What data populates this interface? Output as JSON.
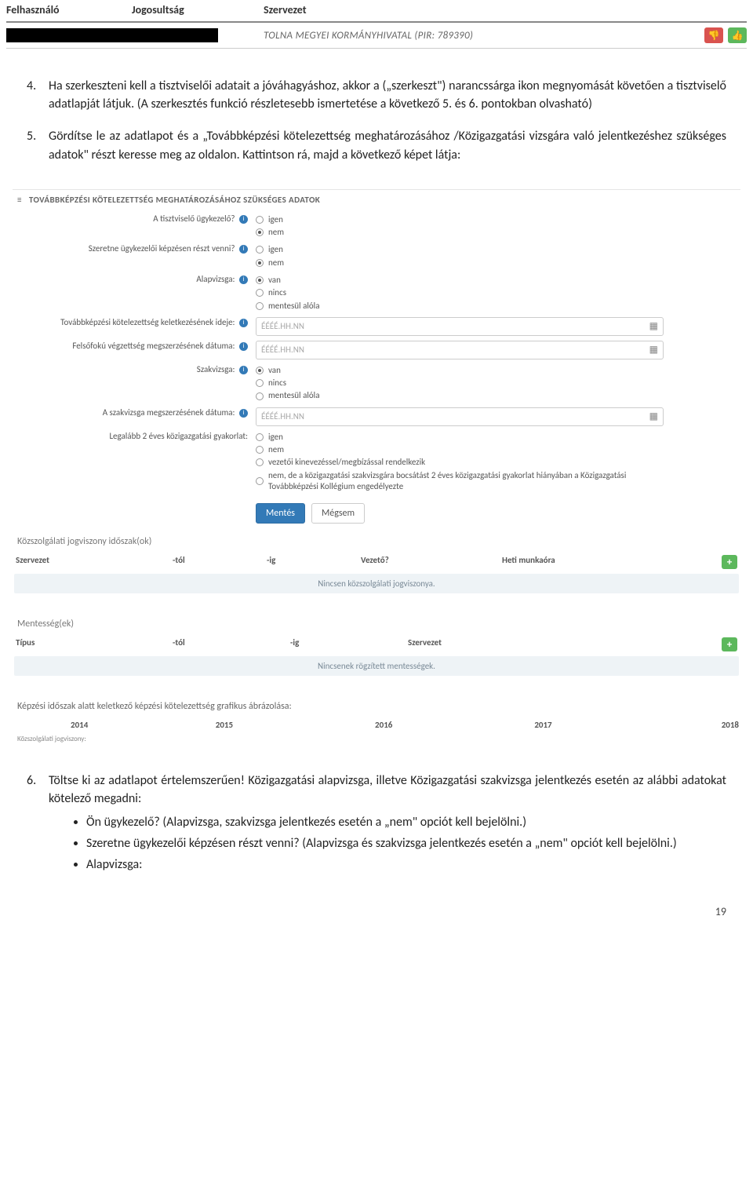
{
  "top": {
    "col1": "Felhasználó",
    "col2": "Jogosultság",
    "col3": "Szervezet",
    "org": "TOLNA MEGYEI KORMÁNYHIVATAL (PIR: 789390)"
  },
  "doc": {
    "p4_num": "4.",
    "p4": "Ha szerkeszteni kell a tisztviselői adatait a jóváhagyáshoz, akkor a („szerkeszt\") narancssárga ikon megnyomását követően a tisztviselő adatlapját látjuk. (A szerkesztés funkció részletesebb ismertetése a következő 5. és 6. pontokban olvasható)",
    "p5_num": "5.",
    "p5": "Gördítse le az adatlapot és a „Továbbképzési kötelezettség meghatározásához /Közigazgatási vizsgára való jelentkezéshez szükséges adatok\" részt keresse meg az oldalon. Kattintson rá, majd a következő képet látja:",
    "p6_num": "6.",
    "p6": "Töltse ki az adatlapot értelemszerűen! Közigazgatási alapvizsga, illetve Közigazgatási szakvizsga jelentkezés esetén az alábbi adatokat kötelező megadni:",
    "b1": "Ön ügykezelő? (Alapvizsga, szakvizsga jelentkezés esetén a „nem\" opciót kell bejelölni.)",
    "b2": "Szeretne ügykezelői képzésen részt venni? (Alapvizsga és szakvizsga jelentkezés esetén a „nem\" opciót kell bejelölni.)",
    "b3": "Alapvizsga:"
  },
  "form": {
    "section_title": "TOVÁBBKÉPZÉSI KÖTELEZETTSÉG MEGHATÁROZÁSÁHOZ SZÜKSÉGES ADATOK",
    "q_ugykezelo": "A tisztviselő ügykezelő?",
    "q_szeretne": "Szeretne ügykezelői képzésen részt venni?",
    "q_alapvizsga": "Alapvizsga:",
    "q_tovabb_kelet": "Továbbképzési kötelezettség keletkezésének ideje:",
    "q_felsofoku": "Felsőfokú végzettség megszerzésének dátuma:",
    "q_szakvizsga": "Szakvizsga:",
    "q_szakv_datum": "A szakvizsga megszerzésének dátuma:",
    "q_gyakorlat": "Legalább 2 éves közigazgatási gyakorlat:",
    "opt_igen": "igen",
    "opt_nem": "nem",
    "opt_van": "van",
    "opt_nincs": "nincs",
    "opt_mentesul": "mentesül alóla",
    "opt_vezetoi": "vezetői kinevezéssel/megbízással rendelkezik",
    "opt_nemde": "nem, de a közigazgatási szakvizsgára bocsátást 2 éves közigazgatási gyakorlat hiányában a Közigazgatási Továbbképzési Kollégium engedélyezte",
    "date_placeholder": "ÉÉÉÉ.HH.NN",
    "btn_save": "Mentés",
    "btn_cancel": "Mégsem"
  },
  "jogv": {
    "title": "Közszolgálati jogviszony időszak(ok)",
    "h_szervezet": "Szervezet",
    "h_tol": "-tól",
    "h_ig": "-ig",
    "h_vezeto": "Vezető?",
    "h_heti": "Heti munkaóra",
    "empty": "Nincsen közszolgálati jogviszonya."
  },
  "ment": {
    "title": "Mentesség(ek)",
    "h_tipus": "Típus",
    "h_tol": "-tól",
    "h_ig": "-ig",
    "h_szervezet": "Szervezet",
    "empty": "Nincsenek rögzített mentességek."
  },
  "graf": {
    "title": "Képzési időszak alatt keletkező képzési kötelezettség grafikus ábrázolása:",
    "y2014": "2014",
    "y2015": "2015",
    "y2016": "2016",
    "y2017": "2017",
    "y2018": "2018",
    "row_label": "Közszolgálati jogviszony:"
  },
  "page": "19"
}
